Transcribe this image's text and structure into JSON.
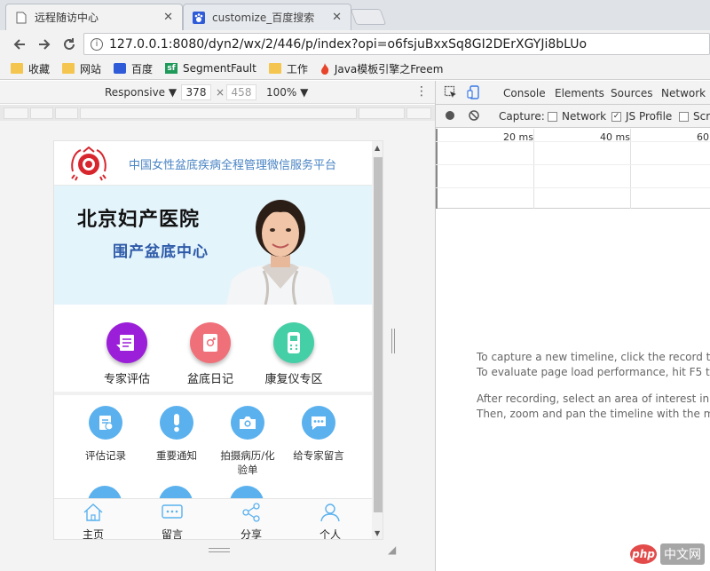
{
  "browser": {
    "tabs": [
      {
        "title": "远程随访中心",
        "active": true
      },
      {
        "title": "customize_百度搜索",
        "active": false
      }
    ],
    "url": "127.0.0.1:8080/dyn2/wx/2/446/p/index?opi=o6fsjuBxxSq8GI2DErXGYJi8bLUo",
    "bookmarks": [
      "收藏",
      "网站",
      "百度",
      "SegmentFault",
      "工作",
      "Java模板引擎之Freem"
    ]
  },
  "device_toolbar": {
    "mode": "Responsive ▼",
    "width": "378",
    "times": "×",
    "height": "458",
    "zoom": "100% ▼",
    "more": "⋮"
  },
  "app": {
    "header_title": "中国女性盆底疾病全程管理微信服务平台",
    "hospital": "北京妇产医院",
    "department": "围产盆底中心",
    "main_features": [
      {
        "label": "专家评估",
        "color": "#9b1fd8"
      },
      {
        "label": "盆底日记",
        "color": "#f0707a"
      },
      {
        "label": "康复仪专区",
        "color": "#45cfa6"
      }
    ],
    "sub_features": [
      {
        "label": "评估记录"
      },
      {
        "label": "重要通知"
      },
      {
        "label": "拍摄病历/化验单"
      },
      {
        "label": "给专家留言"
      }
    ],
    "tabbar": [
      {
        "label": "主页"
      },
      {
        "label": "留言"
      },
      {
        "label": "分享"
      },
      {
        "label": "个人"
      }
    ]
  },
  "devtools": {
    "tabs": [
      "Console",
      "Elements",
      "Sources",
      "Network"
    ],
    "capture_label": "Capture:",
    "options": [
      {
        "label": "Network",
        "checked": false
      },
      {
        "label": "JS Profile",
        "checked": true
      },
      {
        "label": "Scr",
        "checked": false
      }
    ],
    "timeline_labels": [
      "20 ms",
      "40 ms",
      "60"
    ],
    "messages": [
      "To capture a new timeline, click the record tool",
      "To evaluate page load performance, hit F5 to r",
      "After recording, select an area of interest in the",
      "Then, zoom and pan the timeline with the mou"
    ]
  },
  "watermark": {
    "logo": "php",
    "text": "中文网"
  }
}
